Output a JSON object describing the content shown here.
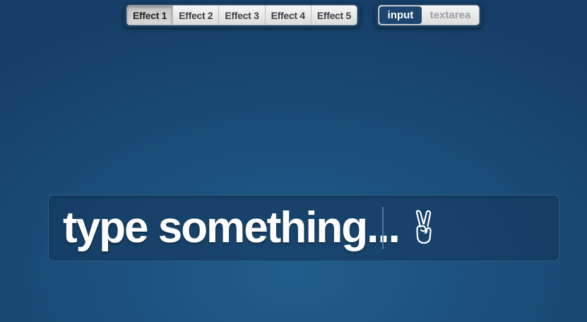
{
  "effects": {
    "tabs": [
      {
        "label": "Effect 1",
        "active": true
      },
      {
        "label": "Effect 2",
        "active": false
      },
      {
        "label": "Effect 3",
        "active": false
      },
      {
        "label": "Effect 4",
        "active": false
      },
      {
        "label": "Effect 5",
        "active": false
      }
    ]
  },
  "mode": {
    "options": [
      "input",
      "textarea"
    ],
    "selected": "input"
  },
  "field": {
    "text": "type something...",
    "icon": "peace-hand-icon"
  },
  "colors": {
    "background": "#1b4f7c",
    "toggle_active": "#1c4670",
    "text": "#ffffff"
  }
}
